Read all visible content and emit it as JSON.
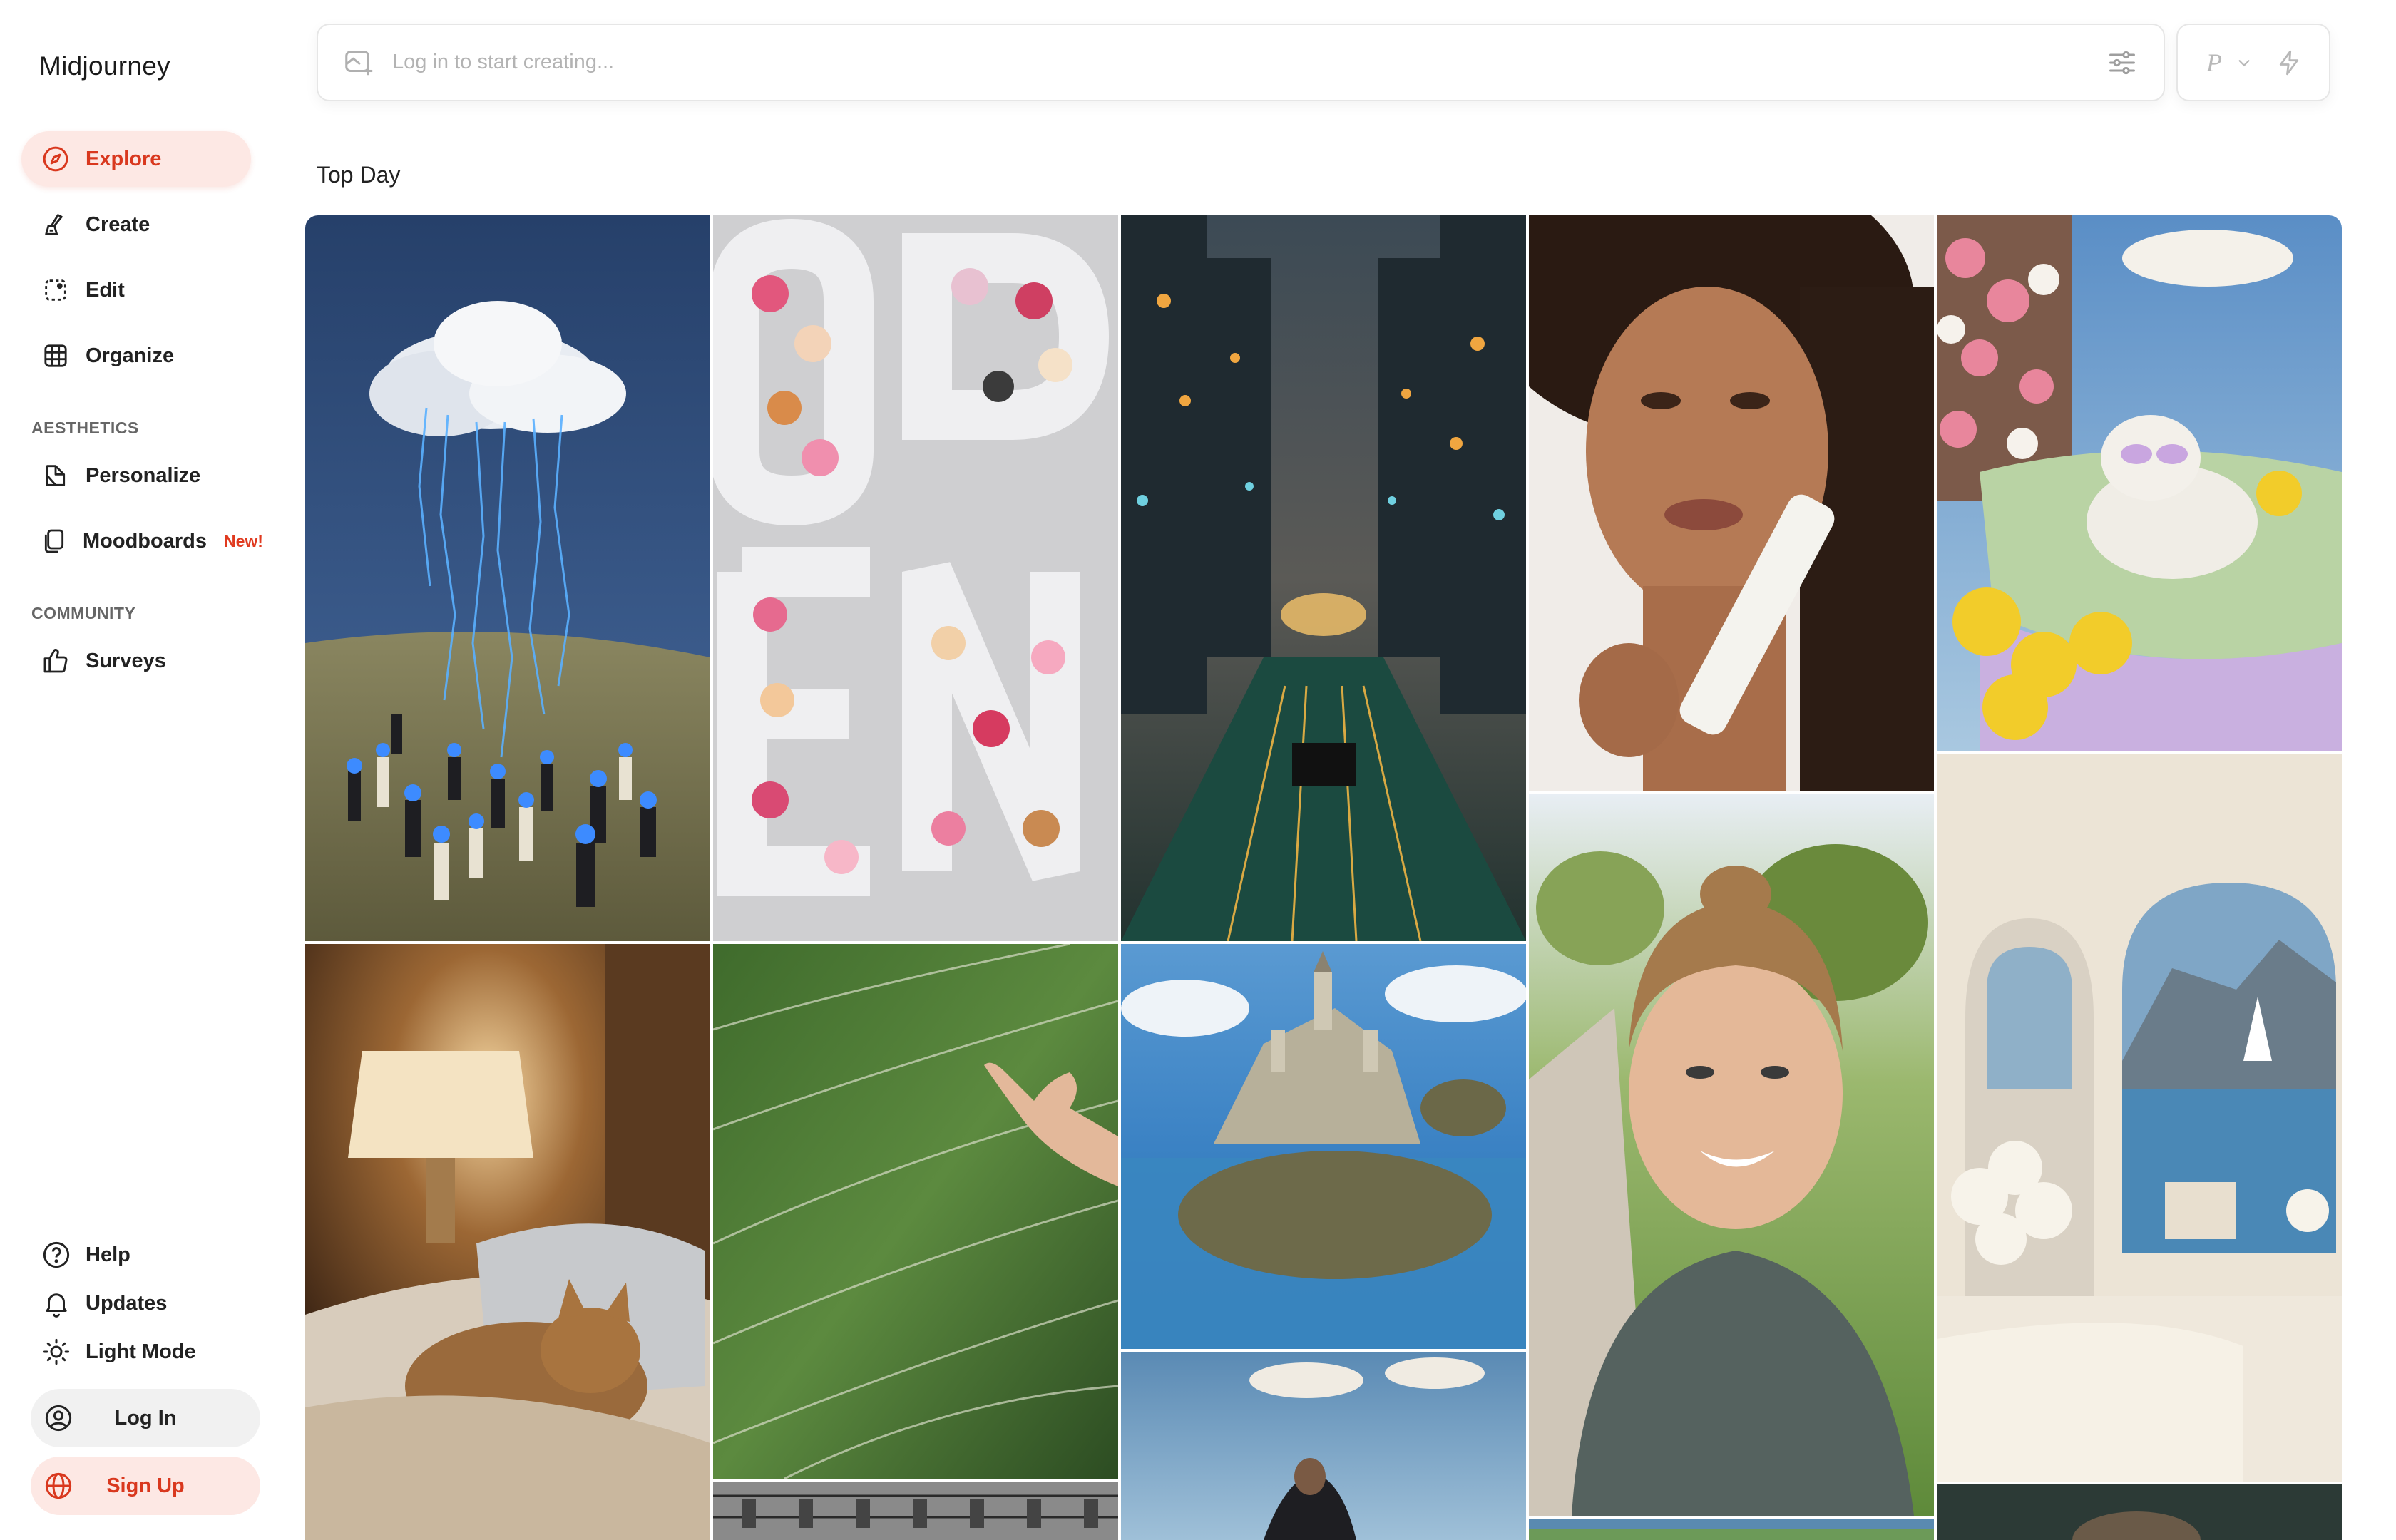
{
  "app": {
    "name": "Midjourney"
  },
  "nav": {
    "explore": "Explore",
    "create": "Create",
    "edit": "Edit",
    "organize": "Organize"
  },
  "aesthetics": {
    "heading": "AESTHETICS",
    "personalize": "Personalize",
    "moodboards": "Moodboards",
    "moodboards_badge": "New!"
  },
  "community": {
    "heading": "COMMUNITY",
    "surveys": "Surveys"
  },
  "bottom": {
    "help": "Help",
    "updates": "Updates",
    "light_mode": "Light Mode",
    "log_in": "Log In",
    "sign_up": "Sign Up"
  },
  "prompt": {
    "placeholder": "Log in to start creating..."
  },
  "mode": {
    "letter": "P"
  },
  "feed": {
    "title": "Top Day"
  },
  "colors": {
    "accent": "#d9381e",
    "accent_bg": "#fde8e4"
  },
  "icons": {
    "explore": "compass-icon",
    "create": "brush-icon",
    "edit": "edit-frame-icon",
    "organize": "grid-icon",
    "personalize": "personalize-icon",
    "moodboards": "moodboard-icon",
    "surveys": "thumbs-up-icon",
    "help": "help-icon",
    "updates": "bell-icon",
    "light_mode": "sun-icon",
    "log_in": "user-icon",
    "sign_up": "globe-icon",
    "prompt": "image-add-icon",
    "settings": "sliders-icon",
    "mode": "chevron-down-icon",
    "speed": "bolt-icon"
  }
}
